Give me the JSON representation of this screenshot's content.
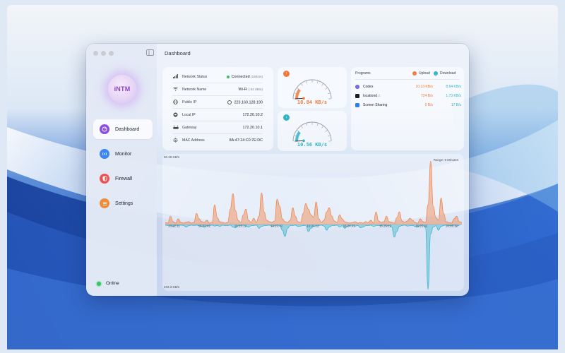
{
  "app": {
    "logo_text": "iNTM",
    "window_title": "Dashboard"
  },
  "sidebar": {
    "items": [
      {
        "label": "Dashboard",
        "icon": "dashboard-gauge-icon",
        "color": "#8a4fe0",
        "active": true
      },
      {
        "label": "Monitor",
        "icon": "antenna-icon",
        "color": "#3b86f2",
        "active": false
      },
      {
        "label": "Firewall",
        "icon": "shield-icon",
        "color": "#ef4f4f",
        "active": false
      },
      {
        "label": "Settings",
        "icon": "list-icon",
        "color": "#f28a38",
        "active": false
      }
    ],
    "status": {
      "label": "Online",
      "color": "#32c85a"
    }
  },
  "network_info": {
    "rows": [
      {
        "label": "Network Status",
        "value": "Connected",
        "detail": "(192ms)",
        "icon": "signal-bars-icon"
      },
      {
        "label": "Network Name",
        "value": "Wi-Fi",
        "detail": "(-32 dBm)",
        "icon": "wifi-icon"
      },
      {
        "label": "Public IP",
        "value": "223.160.128.190",
        "icon": "globe-icon"
      },
      {
        "label": "Local IP",
        "value": "172.20.10.2",
        "icon": "monitor-icon"
      },
      {
        "label": "Gateway",
        "value": "172.20.10.1",
        "icon": "router-icon"
      },
      {
        "label": "MAC Address",
        "value": "8A:47:24:C0:7E:DC",
        "icon": "network-chip-icon"
      }
    ]
  },
  "gauges": {
    "upload": {
      "value": "10.84 KB/s",
      "color": "#f07a3b",
      "icon": "upload-arrow-icon",
      "level": 0.06
    },
    "download": {
      "value": "10.56 KB/s",
      "color": "#2fb3c6",
      "icon": "download-arrow-icon",
      "level": 0.06
    }
  },
  "programs": {
    "title": "Programs",
    "upload_label": "Upload",
    "download_label": "Download",
    "upload_color": "#f07a3b",
    "download_color": "#2fb3c6",
    "rows": [
      {
        "name": "Codex",
        "upload": "10.13 KB/s",
        "download": "8.64 KB/s",
        "icon": "codex-app-icon"
      },
      {
        "name": "locationd",
        "upload": "724 B/s",
        "download": "1.73 KB/s",
        "icon": "terminal-app-icon",
        "apple": ""
      },
      {
        "name": "Screen Sharing",
        "upload": "0 B/s",
        "download": "17 B/s",
        "icon": "screen-sharing-app-icon"
      }
    ]
  },
  "chart_data": {
    "type": "area",
    "range_label": "Range: 5 Minutes",
    "top_label": "90.39 KB/s",
    "bottom_label": "203.3 KB/s",
    "x_ticks": [
      "16:22:11",
      "16:22:42",
      "16:23:12",
      "16:23:42",
      "16:24:12",
      "16:24:42",
      "16:25:12",
      "16:25:42",
      "16:26:12"
    ],
    "series": [
      {
        "name": "Upload",
        "color": "#f07a3b",
        "values": [
          3,
          2,
          12,
          4,
          2,
          8,
          3,
          2,
          3,
          4,
          2,
          3,
          16,
          8,
          4,
          3,
          6,
          2,
          3,
          28,
          10,
          4,
          3,
          2,
          3,
          22,
          44,
          20,
          6,
          3,
          14,
          22,
          6,
          3,
          9,
          3,
          12,
          45,
          18,
          6,
          4,
          3,
          5,
          36,
          26,
          8,
          4,
          3,
          6,
          24,
          12,
          4,
          3,
          16,
          30,
          22,
          14,
          10,
          32,
          8,
          3,
          6,
          18,
          24,
          12,
          5,
          3,
          14,
          8,
          4,
          3,
          2,
          3,
          4,
          2,
          3,
          2,
          4,
          3,
          6,
          2,
          18,
          5,
          3,
          4,
          12,
          4,
          3,
          2,
          10,
          18,
          5,
          3,
          5,
          9,
          6,
          3,
          2,
          8,
          4,
          3,
          28,
          90,
          26,
          10,
          6,
          38,
          16,
          4,
          3,
          2,
          8,
          12,
          4,
          3
        ]
      },
      {
        "name": "Download",
        "color": "#2fb3c6",
        "values": [
          2,
          3,
          2,
          6,
          2,
          3,
          2,
          3,
          8,
          4,
          2,
          3,
          2,
          4,
          6,
          8,
          4,
          3,
          2,
          5,
          3,
          6,
          2,
          4,
          3,
          2,
          8,
          10,
          4,
          3,
          2,
          5,
          8,
          4,
          3,
          2,
          12,
          6,
          4,
          3,
          2,
          6,
          4,
          2,
          3,
          18,
          38,
          12,
          4,
          3,
          2,
          6,
          5,
          3,
          4,
          22,
          12,
          6,
          4,
          3,
          2,
          5,
          18,
          8,
          4,
          3,
          2,
          8,
          4,
          12,
          6,
          3,
          2,
          5,
          3,
          10,
          8,
          4,
          3,
          2,
          6,
          4,
          3,
          4,
          2,
          5,
          3,
          8,
          40,
          22,
          6,
          3,
          2,
          5,
          4,
          3,
          6,
          8,
          3,
          2,
          10,
          203,
          30,
          8,
          4,
          18,
          6,
          3,
          2,
          4,
          3,
          2,
          5,
          3
        ]
      }
    ],
    "ylim_upload": [
      0,
      90.39
    ],
    "ylim_download": [
      0,
      203.3
    ],
    "grid": false,
    "legend": "none"
  }
}
